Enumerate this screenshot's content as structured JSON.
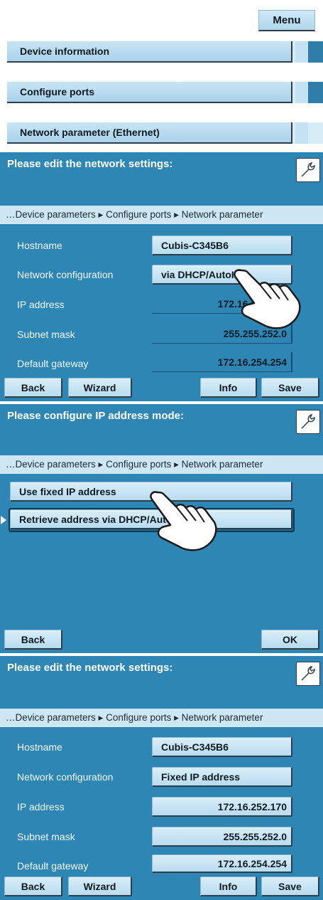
{
  "top_menu": {
    "menu_label": "Menu",
    "items": [
      {
        "label": "Device information"
      },
      {
        "label": "Configure ports"
      },
      {
        "label": "Network parameter (Ethernet)"
      }
    ]
  },
  "panel1": {
    "title": "Please edit the network settings:",
    "breadcrumb": "…Device parameters ▸ Configure ports ▸ Network parameter",
    "rows": [
      {
        "label": "Hostname",
        "value": "Cubis-C345B6"
      },
      {
        "label": "Network configuration",
        "value": "via DHCP/AutoIP"
      },
      {
        "label": "IP address",
        "value": "172.16.252.170"
      },
      {
        "label": "Subnet mask",
        "value": "255.255.252.0"
      },
      {
        "label": "Default gateway",
        "value": "172.16.254.254"
      }
    ],
    "buttons": {
      "back": "Back",
      "wizard": "Wizard",
      "info": "Info",
      "save": "Save"
    }
  },
  "panel2": {
    "title": "Please configure IP address mode:",
    "breadcrumb": "…Device parameters ▸ Configure ports ▸ Network parameter",
    "options": [
      {
        "label": "Use fixed IP address"
      },
      {
        "label": "Retrieve address via DHCP/AutoIP",
        "selected": true
      }
    ],
    "buttons": {
      "back": "Back",
      "ok": "OK"
    }
  },
  "panel3": {
    "title": "Please edit the network settings:",
    "breadcrumb": "…Device parameters ▸ Configure ports ▸ Network parameter",
    "rows": [
      {
        "label": "Hostname",
        "value": "Cubis-C345B6"
      },
      {
        "label": "Network configuration",
        "value": "Fixed IP address"
      },
      {
        "label": "IP address",
        "value": "172.16.252.170"
      },
      {
        "label": "Subnet mask",
        "value": "255.255.252.0"
      },
      {
        "label": "Default gateway",
        "value": "172.16.254.254"
      }
    ],
    "buttons": {
      "back": "Back",
      "wizard": "Wizard",
      "info": "Info",
      "save": "Save"
    }
  },
  "colors": {
    "panel_bg": "#2e86b5",
    "breadcrumb_bg": "#cde7f5",
    "button_bg": "#c9e5f5"
  },
  "icons": [
    "wrench-icon",
    "pointing-hand-icon",
    "selection-arrow-icon"
  ]
}
